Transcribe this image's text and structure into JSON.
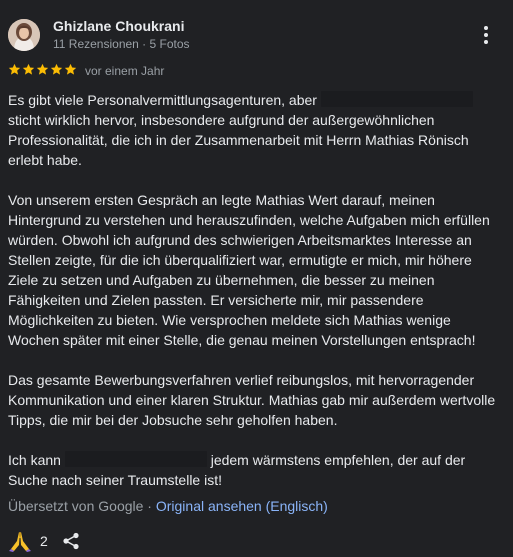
{
  "reviewer": {
    "name": "Ghizlane Choukrani",
    "reviews": "11 Rezensionen",
    "separator": " · ",
    "photos": "5 Fotos"
  },
  "rating": {
    "value": 5,
    "max": 5,
    "color": "#fbbc04"
  },
  "date": "vor einem Jahr",
  "review": {
    "p1_a": "Es gibt viele Personalvermittlungsagenturen, aber ",
    "p1_b": "sticht wirklich hervor, insbesondere aufgrund der außergewöhnlichen Professionalität, die ich in der Zusammenarbeit mit Herrn Mathias Rönisch erlebt habe.",
    "p2": "Von unserem ersten Gespräch an legte Mathias Wert darauf, meinen Hintergrund zu verstehen und herauszufinden, welche Aufgaben mich erfüllen würden. Obwohl ich aufgrund des schwierigen Arbeitsmarktes Interesse an Stellen zeigte, für die ich überqualifiziert war, ermutigte er mich, mir höhere Ziele zu setzen und Aufgaben zu übernehmen, die besser zu meinen Fähigkeiten und Zielen passten. Er versicherte mir, mir passendere Möglichkeiten zu bieten. Wie versprochen meldete sich Mathias wenige Wochen später mit einer Stelle, die genau meinen Vorstellungen entsprach!",
    "p3": "Das gesamte Bewerbungsverfahren verlief reibungslos, mit hervorragender Kommunikation und einer klaren Struktur. Mathias gab mir außerdem wertvolle Tipps, die mir bei der Jobsuche sehr geholfen haben.",
    "p4_a": "Ich kann ",
    "p4_b": " jedem wärmstens empfehlen, der auf der Suche nach seiner Traumstelle ist!"
  },
  "translation": {
    "note": "Übersetzt von Google",
    "separator": " · ",
    "link": "Original ansehen (Englisch)"
  },
  "reactions": {
    "icon": "folded-hands-icon",
    "count": "2"
  },
  "icons": {
    "menu": "more-vert-icon",
    "share": "share-icon",
    "star": "star-icon"
  },
  "colors": {
    "background": "#202124",
    "link": "#8ab4f8",
    "secondary_text": "#9aa0a6"
  }
}
